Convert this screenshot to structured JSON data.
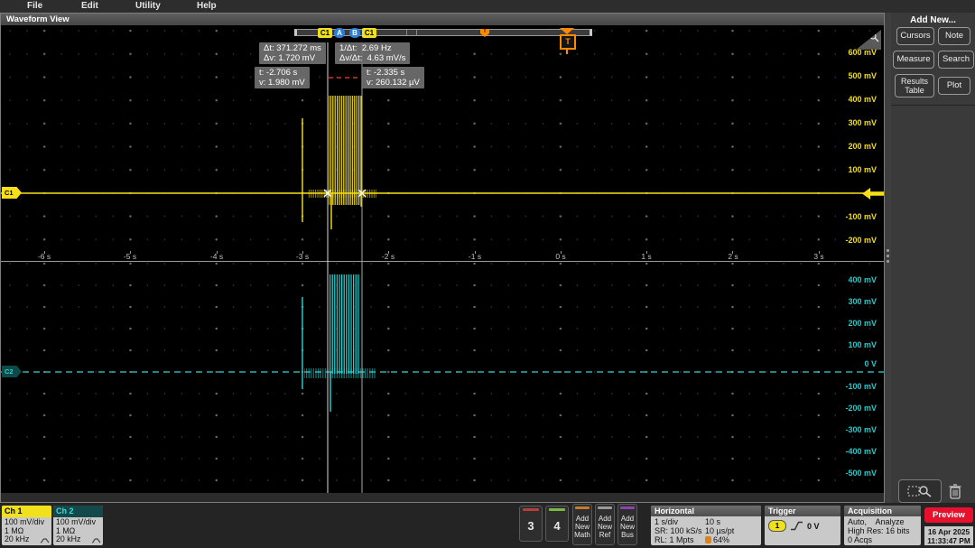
{
  "menu": {
    "items": [
      "File",
      "Edit",
      "Utility",
      "Help"
    ]
  },
  "window": {
    "title": "Waveform View"
  },
  "cursors": {
    "badges": [
      "C1",
      "A",
      "B",
      "C1"
    ],
    "delta_t": "Δt: 371.272 ms",
    "delta_v": "Δv: 1.720 mV",
    "inv_delta_t": "1/Δt:  2.69 Hz",
    "dv_dt": "Δv/Δt:  4.63 mV/s",
    "a_t": "t: -2.706 s",
    "a_v": "v: 1.980 mV",
    "b_t": "t: -2.335 s",
    "b_v": "v: 260.132 µV"
  },
  "axes": {
    "ch1_labels": [
      "600 mV",
      "500 mV",
      "400 mV",
      "300 mV",
      "200 mV",
      "100 mV",
      "-100 mV",
      "-200 mV"
    ],
    "ch2_labels": [
      "400 mV",
      "300 mV",
      "200 mV",
      "100 mV",
      "0 V",
      "-100 mV",
      "-200 mV",
      "-300 mV",
      "-400 mV",
      "-500 mV"
    ],
    "time_labels": [
      "-6 s",
      "-5 s",
      "-4 s",
      "-3 s",
      "-2 s",
      "-1 s",
      "0 s",
      "1 s",
      "2 s",
      "3 s"
    ]
  },
  "markers": {
    "ch1_flag": "C1",
    "ch2_flag": "C2",
    "trigger_flag": "T",
    "overview_trigger": "T"
  },
  "right_panel": {
    "header": "Add New...",
    "buttons": {
      "cursors": "Cursors",
      "note": "Note",
      "measure": "Measure",
      "search": "Search",
      "results_table": "Results Table",
      "plot": "Plot"
    }
  },
  "channels": {
    "ch1": {
      "name": "Ch 1",
      "scale": "100 mV/div",
      "impedance": "1 MΩ",
      "bandwidth": "20 kHz"
    },
    "ch2": {
      "name": "Ch 2",
      "scale": "100 mV/div",
      "impedance": "1 MΩ",
      "bandwidth": "20 kHz"
    },
    "ch3": "3",
    "ch4": "4",
    "add_math": "Add New Math",
    "add_ref": "Add New Ref",
    "add_bus": "Add New Bus"
  },
  "horizontal": {
    "header": "Horizontal",
    "scale": "1 s/div",
    "duration": "10 s",
    "sample_rate": "SR: 100 kS/s",
    "sample_period": "10 µs/pt",
    "record_length": "RL: 1 Mpts",
    "compression": "64%"
  },
  "trigger": {
    "header": "Trigger",
    "source": "1",
    "level": "0 V"
  },
  "acquisition": {
    "header": "Acquisition",
    "mode": "Auto,    Analyze",
    "resolution": "High Res: 16 bits",
    "count": "0 Acqs"
  },
  "preview": {
    "label": "Preview",
    "date": "16 Apr 2025",
    "time": "11:33:47 PM"
  },
  "colors": {
    "ch1": "#f7e017",
    "ch2": "#2ad5d5",
    "trigger": "#ff8a00",
    "preview_red": "#e8112d"
  }
}
